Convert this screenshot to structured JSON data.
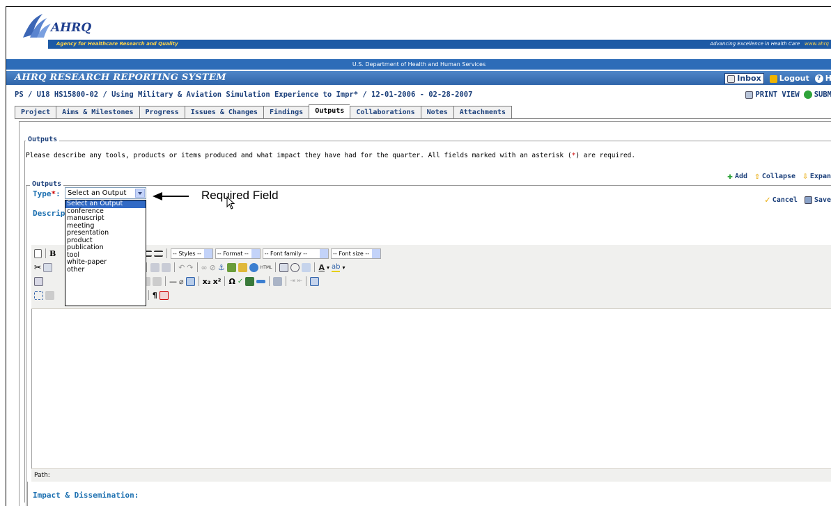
{
  "header": {
    "logo_text": "AHRQ",
    "agency_name": "Agency for Healthcare Research and Quality",
    "tagline": "Advancing Excellence in Health Care",
    "tagline_url": "www.ahrq",
    "department": "U.S. Department of Health and Human Services",
    "system_title": "AHRQ Research Reporting System",
    "inbox_label": "Inbox",
    "logout_label": "Logout",
    "help_label": "H"
  },
  "project": {
    "title": "PS / U18 HS15800-02 / Using Military & Aviation Simulation Experience to Impr* / 12-01-2006 - 02-28-2007",
    "print_view_label": "PRINT VIEW",
    "submit_label": "SUBM"
  },
  "tabs": [
    {
      "label": "Project"
    },
    {
      "label": "Aims & Milestones"
    },
    {
      "label": "Progress"
    },
    {
      "label": "Issues & Changes"
    },
    {
      "label": "Findings"
    },
    {
      "label": "Outputs",
      "active": true
    },
    {
      "label": "Collaborations"
    },
    {
      "label": "Notes"
    },
    {
      "label": "Attachments"
    }
  ],
  "outputs_section": {
    "legend": "Outputs",
    "description_pre": "Please describe any tools, products or items produced and what impact they have had for the quarter. All fields marked with an asterisk (",
    "asterisk": "*",
    "description_post": ") are required.",
    "add_label": "Add",
    "collapse_label": "Collapse",
    "expand_label": "Expan"
  },
  "output_form": {
    "legend": "Outputs",
    "cancel_label": "Cancel",
    "save_label": "Save",
    "type_label": "Type",
    "type_asterisk": "*",
    "type_colon": ":",
    "type_selected": "Select an Output",
    "type_options": [
      "Select an Output",
      "conference",
      "manuscript",
      "meeting",
      "presentation",
      "product",
      "publication",
      "tool",
      "white-paper",
      "other"
    ],
    "description_label": "Descrip",
    "annotation": "Required Field",
    "impact_label": "Impact & Dissemination:"
  },
  "editor": {
    "styles_label": "-- Styles --",
    "format_label": "-- Format --",
    "font_family_label": "-- Font family --",
    "font_size_label": "-- Font size --",
    "path_label": "Path:"
  }
}
